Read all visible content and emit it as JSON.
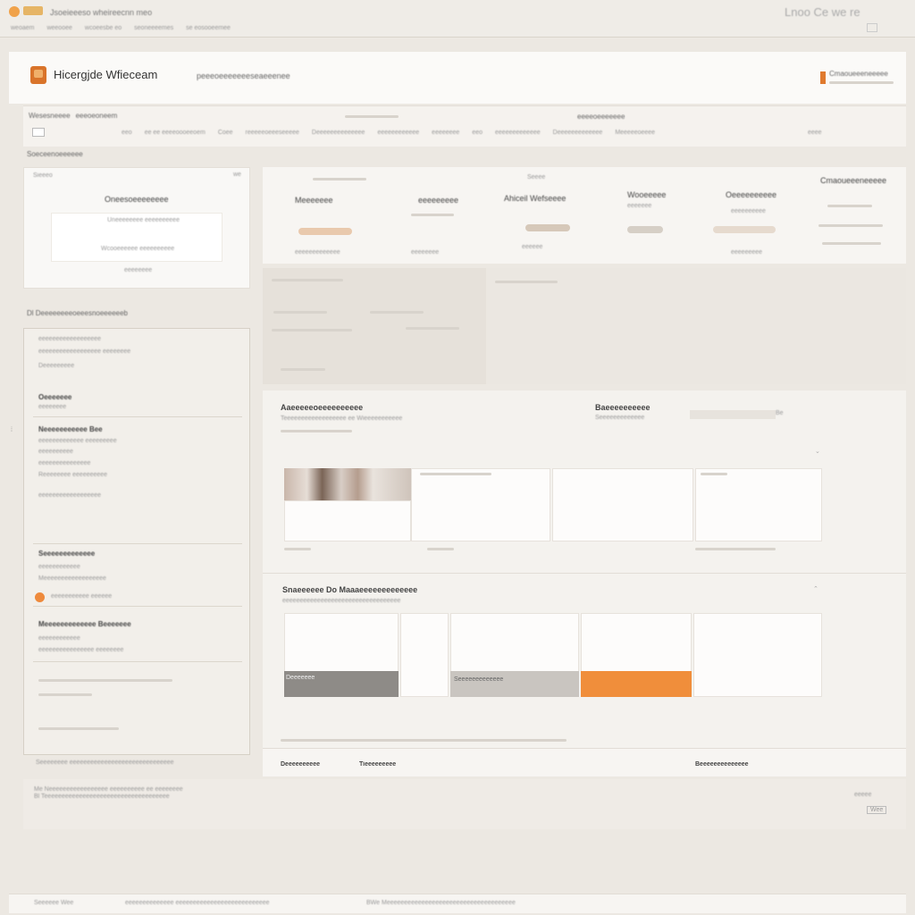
{
  "window": {
    "title": "Jsoeieeeso   wheireecnn   meo",
    "tabs": [
      "weoaem",
      "weeooee",
      "wcoeesbe eo",
      "seoneeeemes",
      "se eosooeemee"
    ],
    "controls": "Lnoo   Ce    we  re"
  },
  "header": {
    "app_name": "Hicergjde Wfieceam",
    "tagline": "peeeoeeeeeeeseaeeenee",
    "account_label": "Cmaoueeeneeeee"
  },
  "subnav": {
    "path": [
      "Wesesneeee",
      "eeeoeoneem"
    ],
    "filter_label": "eeeeoeeeeeee",
    "items": [
      "eeo",
      "ee ee eeeeoooeeoem",
      "Coee",
      "reeeeeoeeeseeeee",
      "Deeeeeeeeeeeeee",
      "eeeeeeeeeeee",
      "eeeeeeee",
      "eeo",
      "eeeeeeeeeeeee",
      "Deeeeeeeeeeeee",
      "Meeeeeoeeee",
      "eeeeee"
    ],
    "right_link": "eeee"
  },
  "page_title": "Soeceenoeeeeee",
  "left_card": {
    "title": "Sieeeo",
    "corner": "we",
    "heading": "Oneesoeeeeeeee",
    "sub": "Uneeeeeeee eeeeeeeeee",
    "body": "Wcooeeeeee eeeeeeeeee",
    "foot": "eeeeeeee"
  },
  "side": {
    "title": "Dl  Deeeeeeeeoeeesnoeeeeeeb",
    "groups": [
      {
        "head": "Oeeeeeee",
        "lines": [
          "eeeeeeeeeeeeeeeeee",
          "eeeeeeeeeeeeeeeeee eeeeeeee",
          "Deeeeeeeee",
          "eeeeeeee"
        ]
      },
      {
        "head": "Neeeeeeeeeee Bee",
        "lines": [
          "eeeeeeeeeeeee  eeeeeeeee",
          "eeeeeeeeee",
          "eeeeeeeeeeeeeee",
          "Reeeeeeee   eeeeeeeeee",
          "eeeeeeeeeeeeeeeeee"
        ]
      },
      {
        "head": "Seeeeeeeeeeeee",
        "lines": [
          "eeeeeeeeeeee",
          "Meeeeeeeeeeeeeeeeee",
          "eeeeeeeeeee   eeeeee"
        ]
      },
      {
        "head": "Meeeeeeeeeeeee Beeeeeee",
        "lines": [
          "eeeeeeeeeeee",
          "eeeeeeeeeeeeeeee  eeeeeeee"
        ]
      }
    ],
    "foot": "Seeeeeeee eeeeeeeeeeeeeeeeeeeeeeeeeeeeee"
  },
  "stats": [
    {
      "label": "Meeeeeee",
      "sub": "eeeeeeeee",
      "value": "eeeeeeeeeeeee"
    },
    {
      "label": "Ahiceil Wefseeee",
      "sub": "Seeee",
      "value": "eeeeeeee"
    },
    {
      "label": "Wooeeeee",
      "sub": "eeeeeee",
      "value": "eeeeee"
    },
    {
      "label": "Oeeeeeeeeee",
      "sub": "eeeeeeeeee",
      "value": "eeeeeeeee"
    }
  ],
  "content": {
    "section1_title": "Aaeeeeeoeeeeeeeeee",
    "section1_sub": "Teeeeeeeeeeeeeeeeee  ee  Wieeeeeeeeeee",
    "section2_title": "Baeeeeeeeeee",
    "section2_sub": "Seeeeeeeeeeeee",
    "search_value": "Be",
    "section3_title": "Snaeeeeee Do Maaaeeeeeeeeeeeee",
    "section3_sub": "eeeeeeeeeeeeeeeeeeeeeeeeeeeeeeeeee",
    "bar_label": "Deeeeeee",
    "bar_label2": "Seeeeeeeeeeeee",
    "footer_left": "Deeeeeeeeee",
    "footer_mid": "Tieeeeeeeee",
    "footer_right": "Beeeeeeeeeeeeee"
  },
  "footer": {
    "line1": "Me  Neeeeeeeeeeeeeeeee  eeeeeeeeee ee  eeeeeeee",
    "line2": "Bl  Teeeeeeeeeeeeeeeeeeeeeeeeeeeeeeeeeeee",
    "right": "eeeee",
    "button": "Wee"
  },
  "bottom": {
    "left": "Seeeeee  Wee",
    "mid": "eeeeeeeeeeeeee eeeeeeeeeeeeeeeeeeeeeeeeeee",
    "right": "BWe   Meeeeeeeeeeeeeeeeeeeeeeeeeeeeeeeeeeeee"
  },
  "colors": {
    "accent": "#f08e3b",
    "panel": "#f4f2ee",
    "background": "#ece8e2"
  }
}
